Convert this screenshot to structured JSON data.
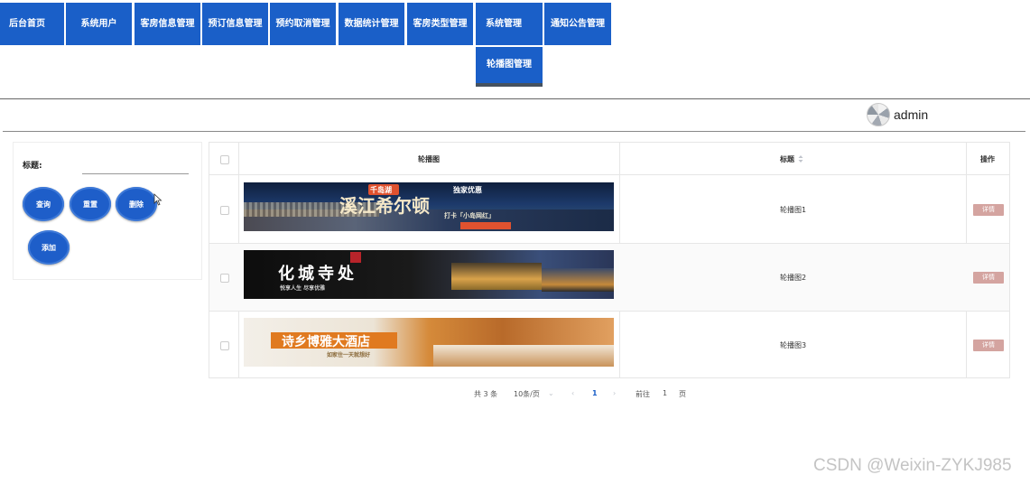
{
  "nav": {
    "items": [
      {
        "label": "后台首页"
      },
      {
        "label": "系统用户"
      },
      {
        "label": "客房信息管理"
      },
      {
        "label": "预订信息管理"
      },
      {
        "label": "预约取消管理"
      },
      {
        "label": "数据统计管理"
      },
      {
        "label": "客房类型管理"
      },
      {
        "label": "系统管理"
      },
      {
        "label": "通知公告管理"
      }
    ],
    "submenu_label": "轮播图管理"
  },
  "user": {
    "name": "admin",
    "avatar_icon": "avatar-icon"
  },
  "search": {
    "title_label": "标题:",
    "title_value": "",
    "buttons": {
      "query": "查询",
      "reset": "重置",
      "delete": "删除",
      "add": "添加"
    }
  },
  "table": {
    "headers": {
      "image": "轮播图",
      "title": "标题",
      "sort_icon": "sort-icon",
      "action": "操作"
    },
    "rows": [
      {
        "title": "轮播图1",
        "action": "详情",
        "banner": {
          "line1": "千岛湖",
          "line2": "溪江希尔顿",
          "line3": "独家优惠",
          "line4": "打卡「小岛网红」"
        }
      },
      {
        "title": "轮播图2",
        "action": "详情",
        "banner": {
          "line1": "化城寺处",
          "line2": "悦享人生 尽享优雅"
        }
      },
      {
        "title": "轮播图3",
        "action": "详情",
        "banner": {
          "line1": "诗乡博雅大酒店",
          "line2": "如家住一天就想好"
        }
      }
    ]
  },
  "pagination": {
    "total": "共 3 条",
    "page_size": "10条/页",
    "current_page": "1",
    "goto_label": "前往",
    "goto_value": "1",
    "page_suffix": "页"
  },
  "watermark": "CSDN @Weixin-ZYKJ985",
  "colors": {
    "primary": "#1a5fc8",
    "detail": "#d4a4a0"
  }
}
